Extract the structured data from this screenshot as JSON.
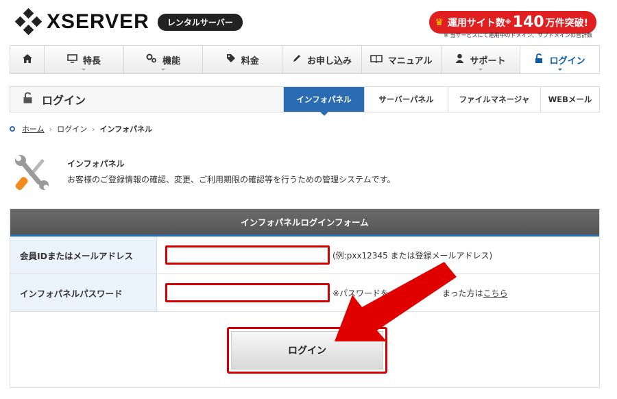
{
  "brand": {
    "logo_text": "XSERVER",
    "badge": "レンタルサーバー"
  },
  "promo": {
    "prefix": "運用サイト数",
    "star": "※",
    "number": "140",
    "suffix": "万件突破!",
    "note": "※ 当サービスにて運用中のドメイン、サブドメインの合計数",
    "color": "#e02020"
  },
  "nav": {
    "items": [
      {
        "icon": "home-icon",
        "label": ""
      },
      {
        "icon": "monitor-icon",
        "label": "特長"
      },
      {
        "icon": "gears-icon",
        "label": "機能"
      },
      {
        "icon": "tag-icon",
        "label": "料金"
      },
      {
        "icon": "pencil-icon",
        "label": "お申し込み"
      },
      {
        "icon": "book-icon",
        "label": "マニュアル"
      },
      {
        "icon": "person-icon",
        "label": "サポート"
      },
      {
        "icon": "unlock-icon",
        "label": "ログイン"
      }
    ]
  },
  "sub": {
    "title": "ログイン",
    "tabs": [
      "インフォパネル",
      "サーバーパネル",
      "ファイルマネージャ",
      "WEBメール"
    ],
    "active_color": "#2a6cb4"
  },
  "breadcrumb": {
    "home": "ホーム",
    "mid": "ログイン",
    "current": "インフォパネル"
  },
  "intro": {
    "title": "インフォパネル",
    "desc": "お客様のご登録情報の確認、変更、ご利用期限の確認等を行うための管理システムです。"
  },
  "form": {
    "heading": "インフォパネルログインフォーム",
    "id_label": "会員IDまたはメールアドレス",
    "id_value": "",
    "id_hint": "(例:pxx12345 または登録メールアドレス)",
    "pw_label": "インフォパネルパスワード",
    "pw_value": "",
    "pw_hint_prefix": "※パスワードを",
    "pw_hint_mid": "まった方は",
    "pw_hint_link": "こちら",
    "submit": "ログイン",
    "highlight_color": "#d40000"
  }
}
